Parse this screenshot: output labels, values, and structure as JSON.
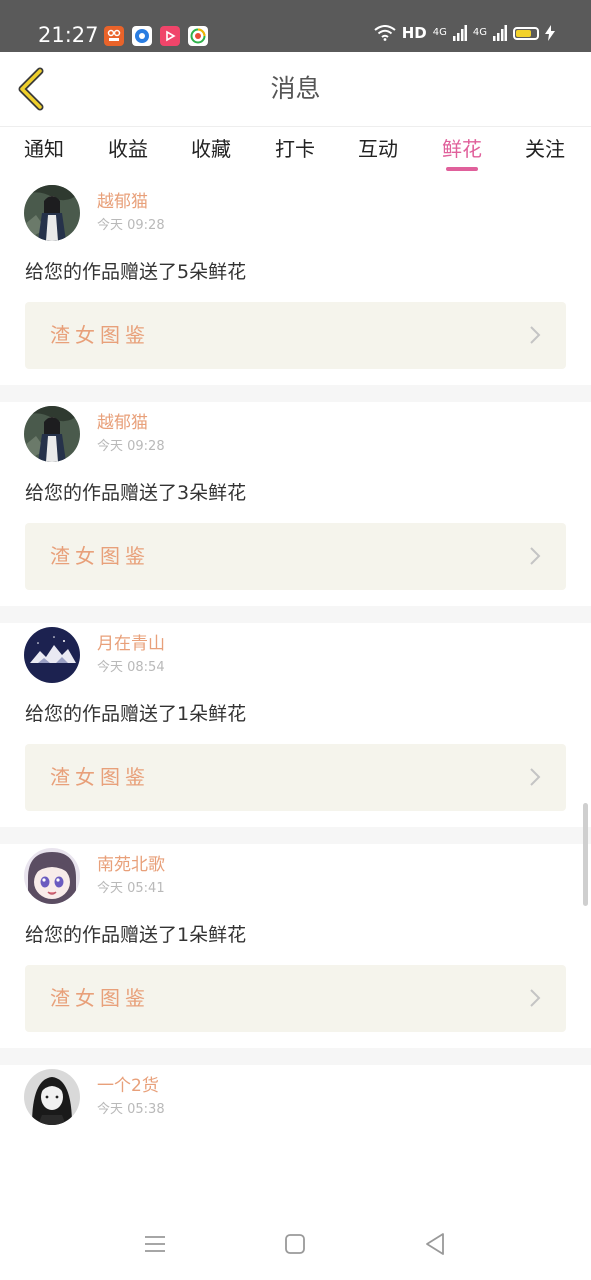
{
  "status_bar": {
    "time": "21:27",
    "hd_label": "HD",
    "signal_1": "4G",
    "signal_2": "4G",
    "battery_level": 0.75,
    "battery_color": "#f3d22a",
    "app_icons": [
      "taobao-style-app-icon",
      "circle-app-icon",
      "video-app-icon",
      "browser-app-icon"
    ]
  },
  "header": {
    "title": "消息",
    "back_icon": "chevron-left-icon",
    "back_color": "#f0d02c"
  },
  "tabs": {
    "items": [
      "通知",
      "收益",
      "收藏",
      "打卡",
      "互动",
      "鲜花",
      "关注"
    ],
    "active_index": 5,
    "active_color": "#e0609b"
  },
  "messages": [
    {
      "user": "越郁猫",
      "time": "今天 09:28",
      "text": "给您的作品赠送了5朵鲜花",
      "work_title": "渣女图鉴",
      "avatar": "photo-avatar-girl"
    },
    {
      "user": "越郁猫",
      "time": "今天 09:28",
      "text": "给您的作品赠送了3朵鲜花",
      "work_title": "渣女图鉴",
      "avatar": "photo-avatar-girl"
    },
    {
      "user": "月在青山",
      "time": "今天 08:54",
      "text": "给您的作品赠送了1朵鲜花",
      "work_title": "渣女图鉴",
      "avatar": "mountain-avatar"
    },
    {
      "user": "南苑北歌",
      "time": "今天 05:41",
      "text": "给您的作品赠送了1朵鲜花",
      "work_title": "渣女图鉴",
      "avatar": "anime-avatar"
    },
    {
      "user": "一个2货",
      "time": "今天 05:38",
      "avatar": "bw-portrait-avatar"
    }
  ],
  "nav_bar": {
    "icons": [
      "menu-icon",
      "home-square-icon",
      "back-triangle-icon"
    ]
  },
  "colors": {
    "username": "#e8a07a",
    "work_card_bg": "#f5f4ec",
    "separator": "#f6f6f6"
  }
}
